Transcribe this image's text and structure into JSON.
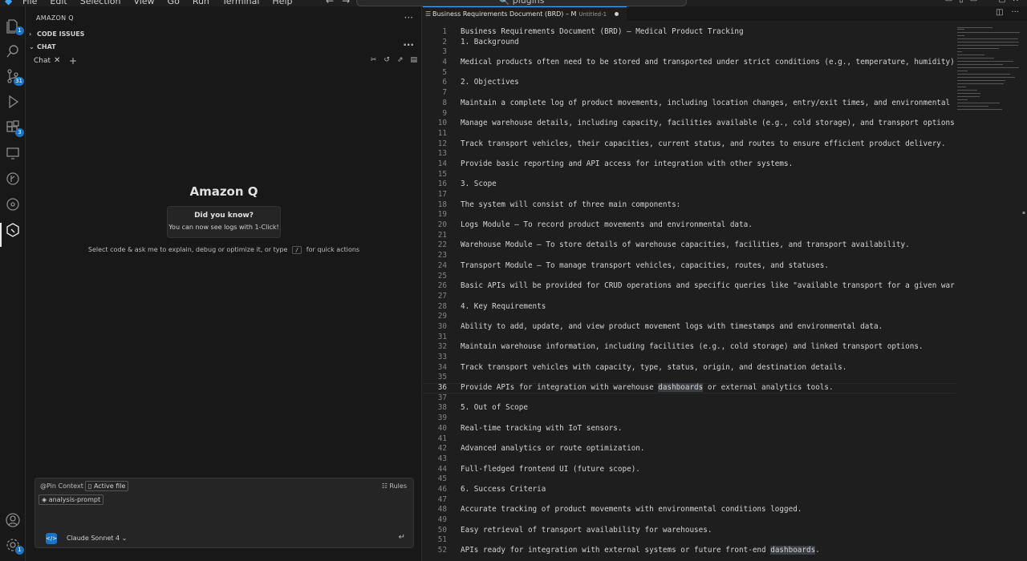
{
  "menubar": {
    "items": [
      "File",
      "Edit",
      "Selection",
      "View",
      "Go",
      "Run",
      "Terminal",
      "Help"
    ],
    "command_center": "plugins"
  },
  "activity": {
    "badges": {
      "explorer": "1",
      "source_control": "31",
      "extensions": "3",
      "accounts_settings": "1"
    }
  },
  "sidepanel": {
    "title": "AMAZON Q",
    "sections": {
      "code_issues": "CODE ISSUES",
      "chat": "CHAT"
    },
    "chat_tab": "Chat",
    "welcome_title": "Amazon Q",
    "did_you_know": {
      "heading": "Did you know?",
      "text": "You can now see logs with 1-Click!"
    },
    "hint_before": "Select code & ask me to explain, debug or optimize it, or type",
    "hint_key": "/",
    "hint_after": "for quick actions",
    "composer": {
      "pin_context": "@Pin Context",
      "active_file": "Active file",
      "prompt_chip": "analysis-prompt",
      "rules": "Rules",
      "model": "Claude Sonnet 4"
    }
  },
  "editor": {
    "tab_title": "Business Requirements Document (BRD) – M",
    "tab_subtitle": "Untitled-1",
    "current_line": 36,
    "lines": [
      "Business Requirements Document (BRD) – Medical Product Tracking",
      "1. Background",
      "",
      "Medical products often need to be stored and transported under strict conditions (e.g., temperature, humidity).",
      "",
      "2. Objectives",
      "",
      "Maintain a complete log of product movements, including location changes, entry/exit times, and environmental",
      "",
      "Manage warehouse details, including capacity, facilities available (e.g., cold storage), and transport options",
      "",
      "Track transport vehicles, their capacities, current status, and routes to ensure efficient product delivery.",
      "",
      "Provide basic reporting and API access for integration with other systems.",
      "",
      "3. Scope",
      "",
      "The system will consist of three main components:",
      "",
      "Logs Module – To record product movements and environmental data.",
      "",
      "Warehouse Module – To store details of warehouse capacities, facilities, and transport availability.",
      "",
      "Transport Module – To manage transport vehicles, capacities, routes, and statuses.",
      "",
      "Basic APIs will be provided for CRUD operations and specific queries like \"available transport for a given war",
      "",
      "4. Key Requirements",
      "",
      "Ability to add, update, and view product movement logs with timestamps and environmental data.",
      "",
      "Maintain warehouse information, including facilities (e.g., cold storage) and linked transport options.",
      "",
      "Track transport vehicles with capacity, type, status, origin, and destination details.",
      "",
      "Provide APIs for integration with warehouse dashboards or external analytics tools.",
      "",
      "5. Out of Scope",
      "",
      "Real-time tracking with IoT sensors.",
      "",
      "Advanced analytics or route optimization.",
      "",
      "Full-fledged frontend UI (future scope).",
      "",
      "6. Success Criteria",
      "",
      "Accurate tracking of product movements with environmental conditions logged.",
      "",
      "Easy retrieval of transport availability for warehouses.",
      "",
      "APIs ready for integration with external systems or future front-end dashboards."
    ]
  }
}
